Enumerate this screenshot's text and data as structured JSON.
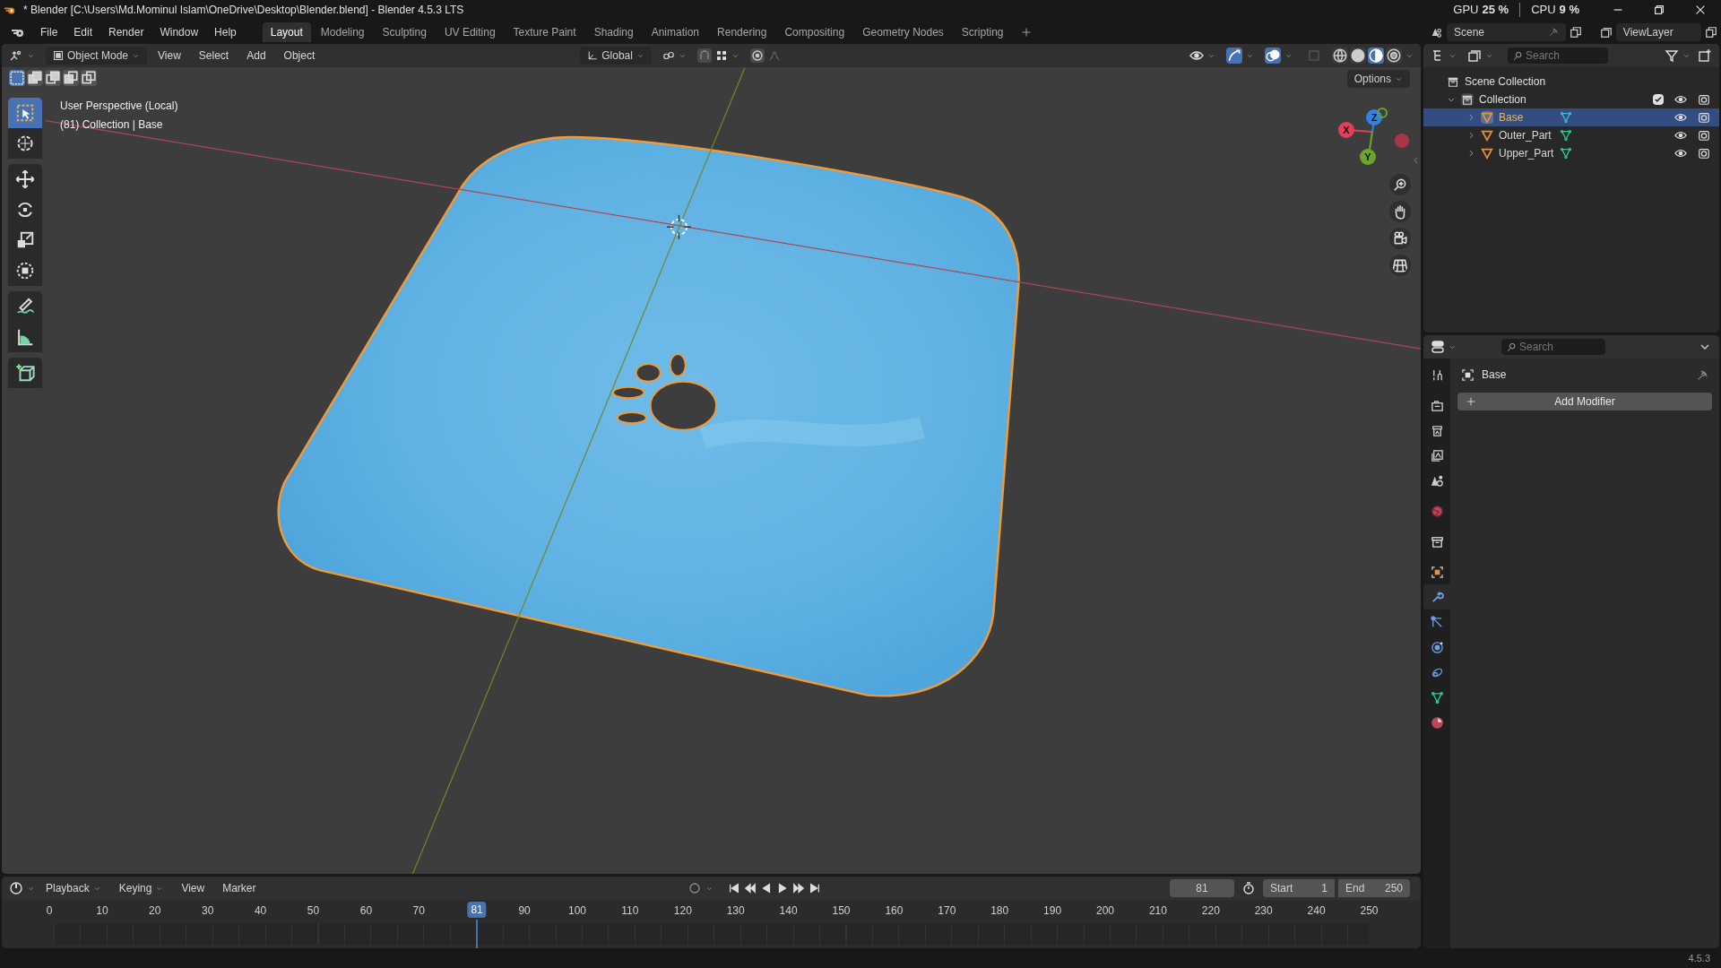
{
  "title_bar": {
    "title": "* Blender [C:\\Users\\Md.Mominul Islam\\OneDrive\\Desktop\\Blender.blend] - Blender 4.5.3 LTS",
    "gpu_label": "GPU",
    "gpu_value": "25 %",
    "cpu_label": "CPU",
    "cpu_value": "9 %"
  },
  "menu": [
    "File",
    "Edit",
    "Render",
    "Window",
    "Help"
  ],
  "workspaces": [
    {
      "label": "Layout",
      "selected": true
    },
    {
      "label": "Modeling",
      "selected": false
    },
    {
      "label": "Sculpting",
      "selected": false
    },
    {
      "label": "UV Editing",
      "selected": false
    },
    {
      "label": "Texture Paint",
      "selected": false
    },
    {
      "label": "Shading",
      "selected": false
    },
    {
      "label": "Animation",
      "selected": false
    },
    {
      "label": "Rendering",
      "selected": false
    },
    {
      "label": "Compositing",
      "selected": false
    },
    {
      "label": "Geometry Nodes",
      "selected": false
    },
    {
      "label": "Scripting",
      "selected": false
    }
  ],
  "scene": "Scene",
  "view_layer": "ViewLayer",
  "viewport": {
    "mode": "Object Mode",
    "menus": [
      "View",
      "Select",
      "Add",
      "Object"
    ],
    "orientation": "Global",
    "options": "Options",
    "info": [
      "User Perspective (Local)",
      "(81) Collection | Base"
    ],
    "tools": [
      {
        "kind": "select",
        "selected": true
      },
      {
        "kind": "cursor",
        "selected": false
      },
      {
        "kind": "move",
        "selected": false
      },
      {
        "kind": "rotate",
        "selected": false
      },
      {
        "kind": "scale",
        "selected": false
      },
      {
        "kind": "transform",
        "selected": false
      },
      {
        "kind": "annotate",
        "selected": false
      },
      {
        "kind": "measure",
        "selected": false
      },
      {
        "kind": "add_cube",
        "selected": false
      }
    ],
    "gizmo": [
      {
        "label": "X",
        "color": "#e2405a"
      },
      {
        "label": "Y",
        "color": "#6ba52b"
      },
      {
        "label": "Z",
        "color": "#2f84e3"
      }
    ]
  },
  "outliner": {
    "search": {
      "placeholder": "Search"
    },
    "root": "Scene Collection",
    "collection": {
      "name": "Collection",
      "expanded": true,
      "checked": true,
      "children": [
        {
          "name": "Base",
          "selected": true
        },
        {
          "name": "Outer_Part",
          "selected": false
        },
        {
          "name": "Upper_Part",
          "selected": false
        }
      ]
    }
  },
  "properties": {
    "search": {
      "placeholder": "Search"
    },
    "object": "Base",
    "button": "Add Modifier",
    "tabs": [
      {
        "kind": "tool",
        "selected": false
      },
      {
        "kind": "render",
        "selected": false
      },
      {
        "kind": "output",
        "selected": false
      },
      {
        "kind": "view_layer",
        "selected": false
      },
      {
        "kind": "scene",
        "selected": false
      },
      {
        "kind": "world",
        "selected": false
      },
      {
        "kind": "collection",
        "selected": false
      },
      {
        "kind": "object",
        "selected": false
      },
      {
        "kind": "modifiers",
        "selected": true
      },
      {
        "kind": "particles",
        "selected": false
      },
      {
        "kind": "physics",
        "selected": false
      },
      {
        "kind": "constraints",
        "selected": false
      },
      {
        "kind": "data",
        "selected": false
      },
      {
        "kind": "material",
        "selected": false
      }
    ]
  },
  "timeline": {
    "menus": [
      "Playback",
      "Keying",
      "View",
      "Marker"
    ],
    "current_frame": "81",
    "start_label": "Start",
    "start": "1",
    "end_label": "End",
    "end": "250",
    "ruler": [
      "0",
      "10",
      "20",
      "30",
      "40",
      "50",
      "60",
      "70",
      "90",
      "100",
      "110",
      "120",
      "130",
      "140",
      "150",
      "160",
      "170",
      "180",
      "190",
      "200",
      "210",
      "220",
      "230",
      "240",
      "250"
    ],
    "playhead": "81"
  },
  "status_bar": {
    "version": "4.5.3"
  }
}
